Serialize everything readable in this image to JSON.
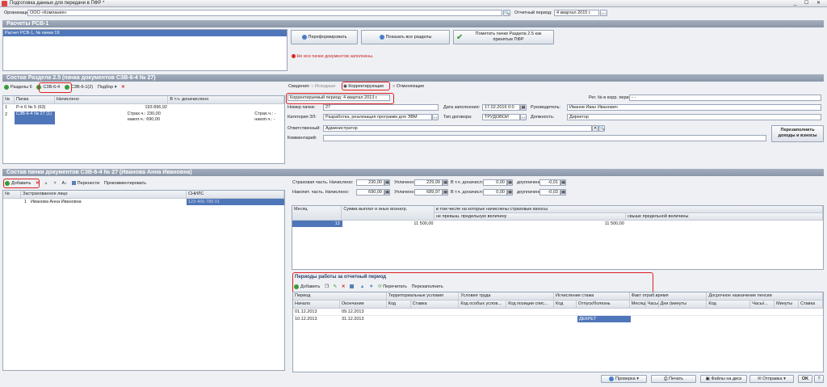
{
  "window": {
    "title": "Подготовка данных для передачи в ПФР *",
    "controls": "_ ☐ ✕"
  },
  "org": {
    "label": "Организация:",
    "value": "ООО «Компания»"
  },
  "period": {
    "label": "Отчетный период:",
    "value": "4 квартал 2015 г."
  },
  "rsv": {
    "title": "Расчеты РСВ-1",
    "item": "Расчет РСВ-1, № пачки 19",
    "reform": "Переформировать",
    "show_all": "Показать все разделы",
    "mark": "Пометить пачки Раздела 2.5 как принятые ПФР",
    "warning": "Не все пачки документов заполнены."
  },
  "sec25": {
    "title": "Состав Раздела 2.5     (пачка документов СЗВ-6-4 № 27)",
    "tabs": [
      "Разделы 6",
      "СЗВ-6-4",
      "СЗВ-6-1(2)",
      "Подбор"
    ],
    "cols": [
      "№",
      "Пачка",
      "Начислено",
      "В т.ч. доначислено"
    ],
    "rows": [
      {
        "n": "1",
        "pack": "Р-п 6 № 5 (63)",
        "sum": "193 896,92",
        "s1": "",
        "s2": ""
      },
      {
        "n": "2",
        "pack": "СЗВ-6-4 № 27 (1)",
        "sum": "",
        "s1": "Страх.ч.: 230,00",
        "s2": "накоп.ч.: 690,00",
        "s3": "Страх.ч.: -",
        "s4": "накоп.ч.: -"
      }
    ]
  },
  "form": {
    "info_label": "Сведения:",
    "radio1": "Исходные",
    "radio2": "Корректирующие",
    "radio3": "Отменяющие",
    "corr_label": "Корректируемый период:",
    "corr_value": "4 квартал 2013 г.",
    "reg_label": "Рег. № в корр. период:",
    "reg_value": "- -",
    "pack_label": "Номер пачки:",
    "pack_value": "27",
    "date_label": "Дата заполнения:",
    "date_value": "17.02.2016  0:0",
    "head_label": "Руководитель:",
    "head_value": "Иванов Иван Иванович",
    "cat_label": "Категория ЗЛ:",
    "cat_value": "Разработка, реализация программ для ЭВМ",
    "contract_label": "Тип договора:",
    "contract_value": "ТРУДОВОЙ",
    "pos_label": "Должность:",
    "pos_value": "Директор",
    "resp_label": "Ответственный:",
    "resp_value": "Администратор",
    "comment_label": "Комментарий:",
    "comment_value": "",
    "refill": "Перезаполнить доходы и взносы"
  },
  "pack": {
    "title": "Состав пачки документов СЗВ-6-4 № 27        (Иванова Анна Ивановна)",
    "add": "Добавить",
    "move": "Перенести",
    "comment": "Прокомментировать",
    "cols": [
      "№",
      "Застрахованное лицо",
      "СНИЛС"
    ],
    "row": {
      "n": "1",
      "name": "Иванова Анна Ивановна",
      "snils": "123-456-789 01"
    }
  },
  "contrib": {
    "ins_label": "Страховая часть. Начислено:",
    "ins_acc": "230,00",
    "paid_label": "Уплачено:",
    "ins_paid": "229,99",
    "extra_label": "В т.ч. доначисл:",
    "ins_extra": "0,00",
    "add_label": "доуплачено:",
    "ins_add": "-0,01",
    "acc_label": "Накопит. часть. Начислено:",
    "acc_acc": "690,00",
    "acc_paid": "689,97",
    "acc_extra": "0,00",
    "acc_add": "-0,03"
  },
  "income": {
    "cols": [
      "Месяц",
      "Сумма выплат и иных вознагр.",
      "в том числе на которые начислены страховые взносы"
    ],
    "sub": [
      "не превыш. предельную величину",
      "свыше предельной величины"
    ],
    "row": {
      "month": "12",
      "sum": "11 500,00",
      "below": "11 500,00",
      "above": ""
    }
  },
  "work": {
    "title": "Периоды работы за отчетный период",
    "add": "Добавить",
    "recalc": "Перечитать",
    "refill": "Перезаполнить",
    "groups": [
      "Период",
      "Территориальные условия",
      "Условия труда",
      "Исчисление стажа",
      "Факт отраб.время",
      "Досрочное назначение пенсии"
    ],
    "cols": [
      "Начало",
      "Окончание",
      "Код",
      "Ставка",
      "Код особых услов...",
      "Код позиции спис...",
      "Код",
      "Отпуск/болезнь",
      "Месяцы",
      "Часы",
      "Дни (минуты",
      "Код",
      "Часы/...",
      "Минуты",
      "Ставка"
    ],
    "rows": [
      {
        "start": "01.12.2013",
        "end": "09.12.2013",
        "leave": ""
      },
      {
        "start": "10.12.2013",
        "end": "31.12.2013",
        "leave": "ДЕКРЕТ"
      }
    ]
  },
  "bottom": {
    "check": "Проверка",
    "print": "Печать",
    "files": "Файлы на диск",
    "send": "Отправка",
    "ok": "OK"
  }
}
